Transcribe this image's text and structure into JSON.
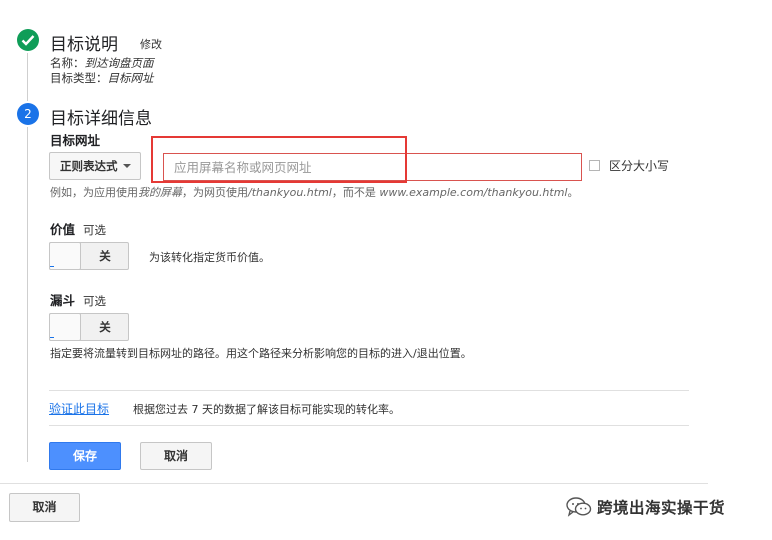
{
  "step1": {
    "title": "目标说明",
    "edit": "修改",
    "name_label": "名称：",
    "name_value": "到达询盘页面",
    "type_label": "目标类型：",
    "type_value": "目标网址"
  },
  "step2": {
    "number": "2",
    "title": "目标详细信息",
    "url_section_label": "目标网址",
    "match_type": "正则表达式",
    "url_placeholder": "应用屏幕名称或网页网址",
    "url_value": "",
    "case_sensitive_label": "区分大小写",
    "case_sensitive_checked": false,
    "hint_prefix": "例如，为应用使用",
    "hint_my_screen": "我的屏幕",
    "hint_middle": "，为网页使用",
    "hint_path": "/thankyou.html",
    "hint_instead": "，而不是",
    "hint_full_url": "www.example.com/thankyou.html",
    "hint_end": "。"
  },
  "value_section": {
    "label": "价值",
    "optional": "可选",
    "toggle_state": "关",
    "note": "为该转化指定货币价值。"
  },
  "funnel_section": {
    "label": "漏斗",
    "optional": "可选",
    "toggle_state": "关",
    "note": "指定要将流量转到目标网址的路径。用这个路径来分析影响您的目标的进入/退出位置。"
  },
  "verify": {
    "link": "验证此目标",
    "description": "根据您过去 7 天的数据了解该目标可能实现的转化率。"
  },
  "actions": {
    "save": "保存",
    "cancel": "取消",
    "outer_cancel": "取消"
  },
  "watermark": {
    "text": "跨境出海实操干货",
    "icon": "wechat-icon"
  },
  "colors": {
    "success": "#0f9d58",
    "accent": "#1a73e8",
    "primary_button": "#4d90fe",
    "highlight": "#e53935",
    "input_error_border": "#d9534f"
  }
}
